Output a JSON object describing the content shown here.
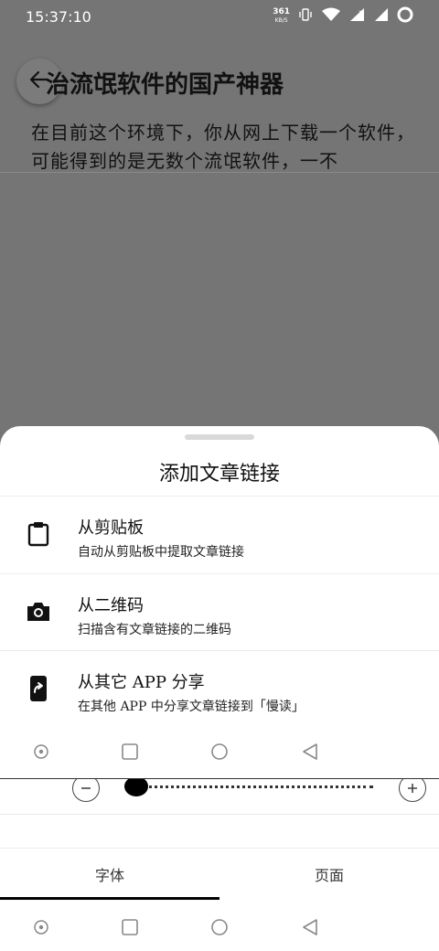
{
  "status_bar": {
    "time": "15:37:10",
    "net_speed_value": "361",
    "net_speed_unit": "KB/S"
  },
  "article": {
    "title": "治流氓软件的国产神器",
    "body": "在目前这个环境下，你从网上下载一个软件，可能得到的是无数个流氓软件，一不"
  },
  "sheet": {
    "title": "添加文章链接",
    "options": [
      {
        "icon": "clipboard-icon",
        "title": "从剪贴板",
        "subtitle": "自动从剪贴板中提取文章链接"
      },
      {
        "icon": "camera-icon",
        "title": "从二维码",
        "subtitle": "扫描含有文章链接的二维码"
      },
      {
        "icon": "share-phone-icon",
        "title": "从其它 APP 分享",
        "subtitle": "在其他 APP 中分享文章链接到「慢读」"
      }
    ]
  },
  "settings": {
    "font_size_level": 0.0,
    "tabs": [
      {
        "label": "字体",
        "active": true
      },
      {
        "label": "页面",
        "active": false
      }
    ]
  },
  "colors": {
    "scrim": "#757575",
    "sheet_background": "#ffffff",
    "text_primary": "#111111",
    "tab_indicator": "#000000"
  }
}
